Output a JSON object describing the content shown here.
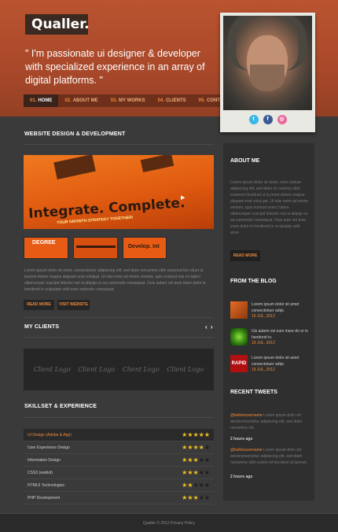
{
  "brand": {
    "logo": "Qualler."
  },
  "header": {
    "tagline": "\" I'm passionate ui designer & developer with specialized experience in an array of digital platforms. \""
  },
  "nav": [
    {
      "num": "01.",
      "label": "HOME"
    },
    {
      "num": "02.",
      "label": "ABOUT ME"
    },
    {
      "num": "03.",
      "label": "MY WORKS"
    },
    {
      "num": "04.",
      "label": "CLIENTS"
    },
    {
      "num": "05.",
      "label": "CONTACTS"
    }
  ],
  "social": {
    "twitter": "t",
    "facebook": "f",
    "dribbble": "◎"
  },
  "main": {
    "section_title": "WEBSITE DESIGN & DEVELOPMENT",
    "hero_headline": "Integrate. Complete.",
    "hero_sub": "YOUR GROWTH STRATEGY TOGETHER!",
    "thumbs": [
      "DEGREE",
      "",
      "Develop. Int"
    ],
    "description": "Lorem ipsum dolor sit amet, consectetuer adipiscing elit, sed diam nonummy nibh euismod tinc idunt ut laoreet dolore magna aliquam erat volutpat. Ut wisi enim ad minim veniam, quis nostrud exe rci tation ullamcorper suscipit lobortis nisl ut aliquip ex ea commodo consequat. Duis autem vel eum iriure dolor in hendrerit in vulputate velit esse molestie consequat.",
    "read_more": "READ MORE",
    "visit_website": "VISIT WEBSITE",
    "clients_title": "MY CLIENTS",
    "prev": "‹",
    "next": "›",
    "client_logos": [
      "Client Logo",
      "Client Logo",
      "Client Logo",
      "Client Logo"
    ],
    "skills_title": "SKILLSET & EXPERIENCE",
    "skills": [
      {
        "label": "UI Design (Adobe & App)",
        "rating": 5
      },
      {
        "label": "User Experience Design",
        "rating": 4
      },
      {
        "label": "Information Design",
        "rating": 3
      },
      {
        "label": "CSS3 (webkit)",
        "rating": 3
      },
      {
        "label": "HTML5 Technologies",
        "rating": 2
      },
      {
        "label": "PHP Development",
        "rating": 3
      }
    ]
  },
  "sidebar": {
    "about_title": "ABOUT ME",
    "about_text": "Lorem ipsum dolor sit amet, cons ctetuer adipiscing elit, sed diam no nummy nibh euismod tincidunt ut la oreet dolore magna aliquam erat volut pat. Ut wisi enim ad minim veniam, quis nostrud exerci tation ullamcorper suscipit lobortis nisl ut aliquip ex ea commodo consequat. Duis aute vel eum iriure dolor in hendrerit in vu lputate velit esse.",
    "read_more": "READ MORE",
    "blog_title": "FROM THE BLOG",
    "blog": [
      {
        "text": "Lorem ipsum dolor sit amet consectetuer adipi.",
        "date": "19 JUL, 2012"
      },
      {
        "text": "Uis autem vel eum iriure do or in hendrerit in.",
        "date": "19 JUL, 2012"
      },
      {
        "text": "Lorem ipsum dolor sit amet consectetuer adipi.",
        "date": "19 JUL, 2012"
      }
    ],
    "blog_thumb_3_text": "RAPID",
    "tweets_title": "RECENT TWEETS",
    "tweets": [
      {
        "handle": "@twitterusername",
        "text": " Lorem ipsum dolo rsit ametconsectetur adipiscing elit, sed diam nonummy nib.",
        "time": "2 hours ago"
      },
      {
        "handle": "@twitterusername",
        "text": " Lorem ipsum dolo rsit ametconsectetur adipiscing elit, sed diam nonummy nibh euism od tincidunt ut laoreet.",
        "time": "2 hours ago"
      }
    ]
  },
  "footer": {
    "text": "Qualler © 2012 Privacy Policy"
  }
}
